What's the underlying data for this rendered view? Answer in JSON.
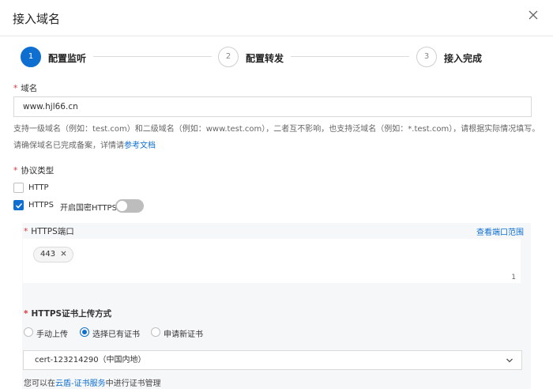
{
  "dialog": {
    "title": "接入域名"
  },
  "steps": [
    {
      "num": "1",
      "label": "配置监听"
    },
    {
      "num": "2",
      "label": "配置转发"
    },
    {
      "num": "3",
      "label": "接入完成"
    }
  ],
  "domain": {
    "label": "域名",
    "value": "www.hjl66.cn",
    "help1": "支持一级域名（例如：test.com）和二级域名（例如：www.test.com），二者互不影响，也支持泛域名（例如：*.test.com），请根据实际情况填写。",
    "help2_prefix": "请确保域名已完成备案，详情请",
    "help2_link": "参考文档"
  },
  "protocol": {
    "label": "协议类型",
    "http": "HTTP",
    "https": "HTTPS",
    "gm_label": "开启国密HTTPS"
  },
  "https_port": {
    "label": "HTTPS端口",
    "view_link": "查看端口范围",
    "tag": "443",
    "count": "1"
  },
  "cert": {
    "label": "HTTPS证书上传方式",
    "options": [
      "手动上传",
      "选择已有证书",
      "申请新证书"
    ],
    "selected": "cert-123214290（中国内地）",
    "footer_prefix": "您可以在",
    "footer_link": "云盾-证书服务",
    "footer_suffix": "中进行证书管理"
  },
  "icons": {
    "close": "close-icon",
    "check": "check-icon",
    "tag_remove": "close-icon",
    "dropdown": "chevron-down-icon"
  },
  "colors": {
    "accent": "#0f6fd1",
    "required": "#d9363e"
  }
}
